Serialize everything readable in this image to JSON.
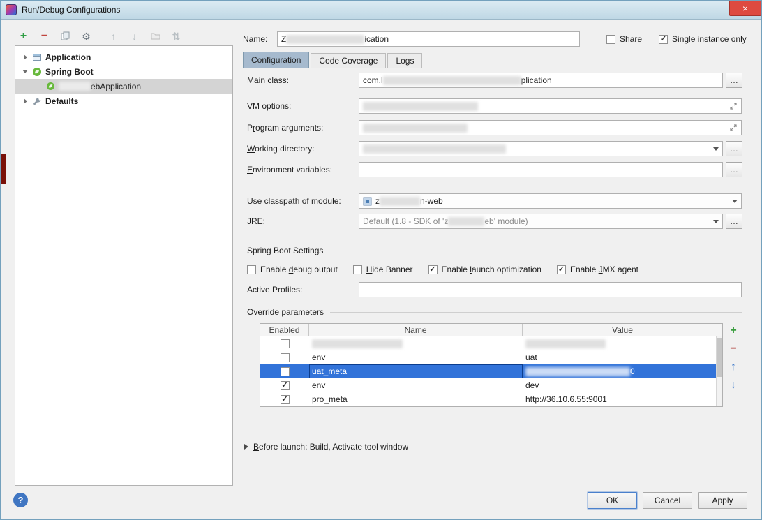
{
  "window": {
    "title": "Run/Debug Configurations"
  },
  "icons": {
    "close": "×",
    "plus": "+",
    "minus": "−",
    "gear": "⚙",
    "arrow_up": "↑",
    "arrow_down": "↓",
    "sort": "⇅",
    "check": "✓",
    "ellipsis": "…",
    "help": "?"
  },
  "sidebar": {
    "tree": [
      {
        "label": "Application"
      },
      {
        "label": "Spring Boot"
      },
      {
        "label_suffix": "ebApplication"
      },
      {
        "label": "Defaults"
      }
    ]
  },
  "header": {
    "name_label": "Name:",
    "name_value_prefix": "Z",
    "name_value_suffix": "ication",
    "share_label": "Share",
    "share_check": "",
    "single_instance_label": "Single instance only",
    "single_instance_check": "✓"
  },
  "tabs": [
    {
      "label": "Configuration"
    },
    {
      "label": "Code Coverage"
    },
    {
      "label": "Logs"
    }
  ],
  "form": {
    "main_class_label": "Main class:",
    "main_class_prefix": "com.l",
    "main_class_suffix": "plication",
    "vm_options": {
      "pre": "",
      "key": "V",
      "post": "M options:"
    },
    "program_arguments": {
      "pre": "P",
      "key": "r",
      "post": "ogram arguments:"
    },
    "working_directory": {
      "pre": "",
      "key": "W",
      "post": "orking directory:"
    },
    "environment_variables": {
      "pre": "",
      "key": "E",
      "post": "nvironment variables:"
    },
    "classpath": {
      "pre": "Use classpath of mo",
      "key": "d",
      "post": "ule:"
    },
    "classpath_value_prefix": "z",
    "classpath_value_suffix": "n-web",
    "jre_label": "JRE:",
    "jre_value_prefix": "Default (1.8 - SDK of 'z",
    "jre_value_suffix": "eb' module)"
  },
  "spring": {
    "title": "Spring Boot Settings",
    "cb1": {
      "pre": "Enable ",
      "key": "d",
      "post": "ebug output",
      "check": ""
    },
    "cb2": {
      "pre": "",
      "key": "H",
      "post": "ide Banner",
      "check": ""
    },
    "cb3": {
      "pre": "Enable ",
      "key": "l",
      "post": "aunch optimization",
      "check": "✓"
    },
    "cb4": {
      "pre": "Enable ",
      "key": "J",
      "post": "MX agent",
      "check": "✓"
    },
    "active_profiles_label": "Active Profiles:"
  },
  "override": {
    "title": "Override parameters",
    "columns": [
      "Enabled",
      "Name",
      "Value"
    ],
    "rows": [
      {
        "check": "",
        "name": "",
        "value": ""
      },
      {
        "check": "",
        "name": "env",
        "value": "uat"
      },
      {
        "check": "",
        "name": "uat_meta",
        "value": "",
        "value_suffix": "0"
      },
      {
        "check": "✓",
        "name": "env",
        "value": "dev"
      },
      {
        "check": "✓",
        "name": "pro_meta",
        "value": "http://36.10.6.55:9001"
      }
    ]
  },
  "before_launch": {
    "pre": "",
    "key": "B",
    "post": "efore launch: Build, Activate tool window"
  },
  "footer": {
    "ok": "OK",
    "cancel": "Cancel",
    "apply": "Apply"
  }
}
